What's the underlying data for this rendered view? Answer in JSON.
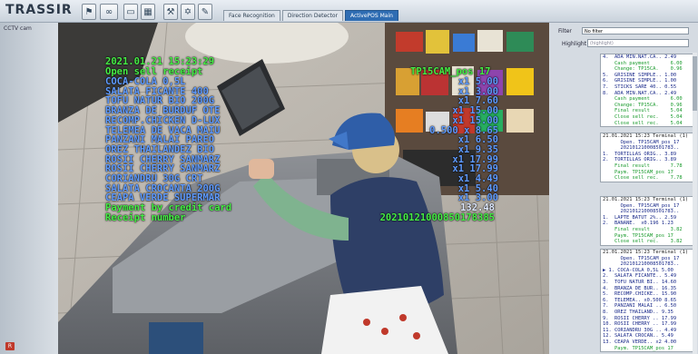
{
  "app": {
    "logo_text": "TRASSIR"
  },
  "toolbar": {
    "icons": [
      "bell-icon",
      "link-icon",
      "chat-icon",
      "grid-icon",
      "wrench-icon",
      "puzzle-icon",
      "edit-icon"
    ]
  },
  "tabs": [
    {
      "label": "Face Recognition",
      "active": false
    },
    {
      "label": "Direction Detector",
      "active": false
    },
    {
      "label": "ActivePOS Main",
      "active": true
    }
  ],
  "left_panel": {
    "label": "CCTV cam"
  },
  "video_overlay": {
    "timestamp": "2021.01.21 15:23:29",
    "header_left": "Open sell receipt",
    "header_right": "TP15CAM_pos 17",
    "items": [
      {
        "name": "COCA-COLA 0,5L",
        "qty": "x1 5.00"
      },
      {
        "name": "SALATA FICANTE 400",
        "qty": "x1 3.00"
      },
      {
        "name": "TOFU NATUR BIO 200G",
        "qty": "x1 7.60"
      },
      {
        "name": "BRANZA DE BURDUF OTE",
        "qty": "x1 15.00"
      },
      {
        "name": "RECOMP.CHICKEN D-LUX",
        "qty": "x1 15.00"
      },
      {
        "name": "TELEMEA DE VACA MAIU",
        "qty": "0.500 x 8.65"
      },
      {
        "name": "PANZANI MALAI PAREO",
        "qty": "x1 6.50"
      },
      {
        "name": "OREZ THAILANDEZ BIO",
        "qty": "x1 9.35"
      },
      {
        "name": "ROSII CHERRY SANMARZ",
        "qty": "x1 17.99"
      },
      {
        "name": "ROSII CHERRY SANMARZ",
        "qty": "x1 17.99"
      },
      {
        "name": "CORIANDRU 30G CRT",
        "qty": "x1 4.49"
      },
      {
        "name": "SALATA CROCANTA 200G",
        "qty": "x1 5.40"
      },
      {
        "name": "CEAPA VERDE SUPERMAR",
        "qty": "x1 3.00"
      }
    ],
    "payment_line": "Payment by credit card",
    "receipt_label": "Receipt number",
    "total": "132.48",
    "receipt_number": "20210121000850178385"
  },
  "right_panel": {
    "filter_label": "Filter",
    "filter_value": "No filter",
    "highlight_label": "Highlight",
    "highlight_placeholder": "(highlight)",
    "cards": [
      {
        "lines": [
          {
            "t": "4.  ADA MIN.NAT.CA.. 2.49",
            "c": "b"
          },
          {
            "t": "    Cash payment       6.00",
            "c": "g"
          },
          {
            "t": "    Change: TP15CA.    0.96",
            "c": "g"
          },
          {
            "t": "5.  GRISINE SIMPLE.. 1.00",
            "c": "b"
          },
          {
            "t": "6.  GRISINE SIMPLE.. 1.00",
            "c": "b"
          },
          {
            "t": "7.  STICKS SARE 40.. 0.55",
            "c": "b"
          },
          {
            "t": "8.  ADA MIN.NAT.CA.. 2.49",
            "c": "b"
          },
          {
            "t": "    Cash payment       6.00",
            "c": "g"
          },
          {
            "t": "    Change: TP15CA.    0.96",
            "c": "g"
          },
          {
            "t": "    Final result       5.04",
            "c": "g"
          },
          {
            "t": "    Close sell rec.    5.04",
            "c": "g"
          },
          {
            "t": "    Close sell rec.    5.04",
            "c": "g"
          }
        ]
      },
      {
        "lines": [
          {
            "t": "21.01.2021 15:23 Terminal (1)",
            "c": "k"
          },
          {
            "t": "      Open. TP15CAM_pos_17",
            "c": "b"
          },
          {
            "t": "      202101210008501783..",
            "c": "b"
          },
          {
            "t": "1.  TORTILLAS ORIG.. 3.89",
            "c": "b"
          },
          {
            "t": "2.  TORTILLAS ORIG.. 3.89",
            "c": "b"
          },
          {
            "t": "    Final result       7.78",
            "c": "g"
          },
          {
            "t": "    Paym. TP15CAM_pos 17",
            "c": "g"
          },
          {
            "t": "    Close sell rec.    7.78",
            "c": "g"
          }
        ]
      },
      {
        "lines": [
          {
            "t": "21.01.2021 15:23 Terminal (1)",
            "c": "k"
          },
          {
            "t": "      Open. TP15CAM_pos_17",
            "c": "b"
          },
          {
            "t": "      202101210008501783..",
            "c": "b"
          },
          {
            "t": "1.  LAPTE BATUT 2%.. 2.59",
            "c": "b"
          },
          {
            "t": "2.  BANANE.  x0.196 1.23",
            "c": "b"
          },
          {
            "t": "    Final result       3.82",
            "c": "g"
          },
          {
            "t": "    Paym. TP15CAM_pos 17",
            "c": "g"
          },
          {
            "t": "    Close sell rec.    3.82",
            "c": "g"
          }
        ]
      },
      {
        "lines": [
          {
            "t": "21.01.2021 15:23 Terminal (1)",
            "c": "k"
          },
          {
            "t": "      Open. TP15CAM_pos_17",
            "c": "b"
          },
          {
            "t": "      202101210008501783..",
            "c": "b"
          },
          {
            "t": "▶ 1. COCA-COLA 0,5L 5.00",
            "c": "b"
          },
          {
            "t": "2.  SALATA FICANTE.. 5.49",
            "c": "b"
          },
          {
            "t": "3.  TOFU NATUR BI.. 14.60",
            "c": "b"
          },
          {
            "t": "4.  BRANZA DE BUR.. 16.35",
            "c": "b"
          },
          {
            "t": "5.  RECOMP.CHICKE.. 15.90",
            "c": "b"
          },
          {
            "t": "6.  TELEMEA.. x0.500 8.65",
            "c": "b"
          },
          {
            "t": "7.  PANZANI MALAI .. 6.50",
            "c": "b"
          },
          {
            "t": "8.  OREZ THAILAND.. 9.35",
            "c": "b"
          },
          {
            "t": "9.  ROSII CHERRY .. 17.99",
            "c": "b"
          },
          {
            "t": "10. ROSII CHERRY .. 17.99",
            "c": "b"
          },
          {
            "t": "11. CORIANDRU 30G .. 4.49",
            "c": "b"
          },
          {
            "t": "12. SALATA CROCAN.. 5.49",
            "c": "b"
          },
          {
            "t": "13. CEAPA VERDE.. x2 4.00",
            "c": "b"
          },
          {
            "t": "    Paym. TP15CAM_pos 17",
            "c": "g"
          }
        ]
      }
    ]
  },
  "status": {
    "badge": "R"
  }
}
